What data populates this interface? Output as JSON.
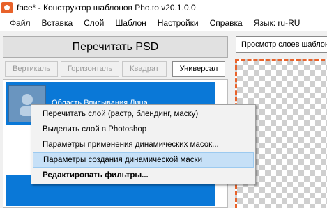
{
  "window": {
    "title": "face* - Конструктор шаблонов Pho.to v20.1.0.0"
  },
  "menu": [
    "Файл",
    "Вставка",
    "Слой",
    "Шаблон",
    "Настройки",
    "Справка",
    "Язык: ru-RU"
  ],
  "toolbar": {
    "reload_psd": "Перечитать PSD",
    "buttons": [
      "Вертикаль",
      "Горизонталь",
      "Квадрат",
      "Универсал"
    ]
  },
  "layer_list": {
    "items": [
      {
        "name": "Область Вписывания Лица"
      }
    ]
  },
  "right_panel": {
    "preview_label": "Просмотр слоев шаблона"
  },
  "context_menu": {
    "items": [
      {
        "label": "Перечитать слой (растр, блендинг, маску)"
      },
      {
        "label": "Выделить слой в Photoshop"
      },
      {
        "label": "Параметры применения динамических масок..."
      },
      {
        "label": "Параметры создания динамической маски"
      },
      {
        "label": "Редактировать фильтры..."
      }
    ]
  },
  "colors": {
    "selection_blue": "#0a78d7",
    "hover_blue": "#c6e0f7",
    "accent_orange": "#e8622a"
  }
}
